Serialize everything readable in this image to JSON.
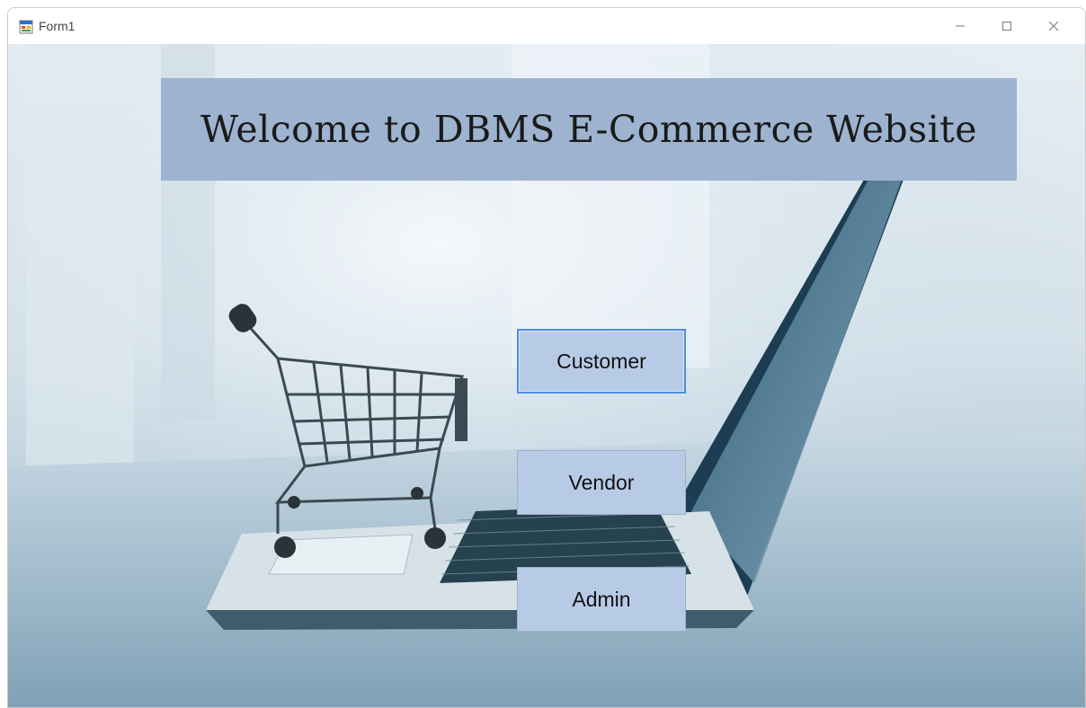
{
  "window": {
    "title": "Form1",
    "controls": {
      "minimize": "—",
      "maximize": "☐",
      "close": "✕"
    }
  },
  "banner": {
    "text": "Welcome to DBMS E-Commerce Website"
  },
  "buttons": {
    "customer": "Customer",
    "vendor": "Vendor",
    "admin": "Admin"
  },
  "colors": {
    "banner_bg": "#9db3cf",
    "button_bg": "#b8cbe6",
    "focus_border": "#4e8ede"
  },
  "background": {
    "image": "shopping-cart-on-laptop-photo"
  }
}
